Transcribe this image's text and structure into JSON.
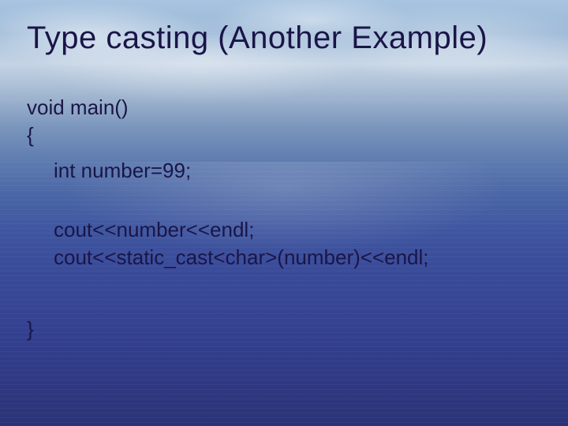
{
  "slide": {
    "title": "Type casting (Another Example)",
    "code": {
      "line1": "void main()",
      "line2": "{",
      "line3": "int number=99;",
      "line4": "cout<<number<<endl;",
      "line5": "cout<<static_cast<char>(number)<<endl;",
      "line6": "}"
    }
  }
}
